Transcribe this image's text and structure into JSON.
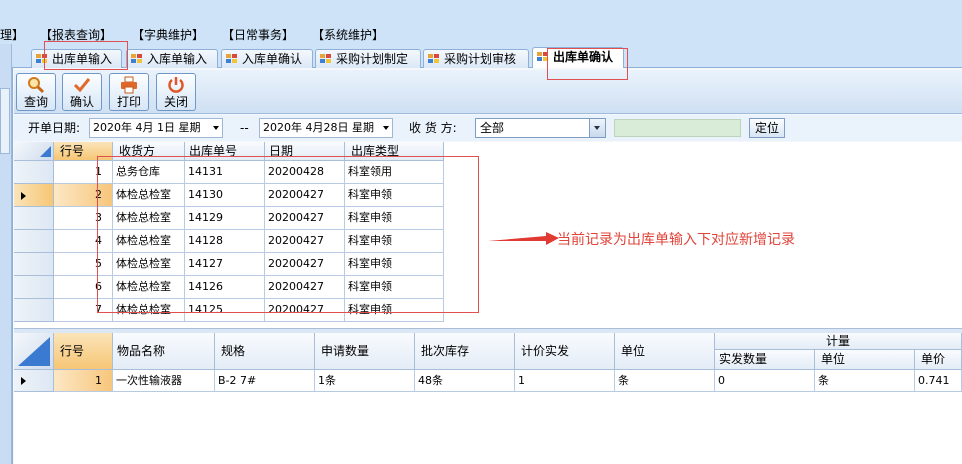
{
  "menu": {
    "items": [
      "理】",
      "【报表查询】",
      "【字典维护】",
      "【日常事务】",
      "【系统维护】"
    ]
  },
  "tabs": [
    {
      "label": "出库单输入",
      "active": false
    },
    {
      "label": "入库单输入",
      "active": false
    },
    {
      "label": "入库单确认",
      "active": false
    },
    {
      "label": "采购计划制定",
      "active": false
    },
    {
      "label": "采购计划审核",
      "active": false
    },
    {
      "label": "出库单确认",
      "active": true
    }
  ],
  "toolbar": {
    "query_label": "查询",
    "confirm_label": "确认",
    "print_label": "打印",
    "close_label": "关闭"
  },
  "filter": {
    "date_label": "开单日期:",
    "date_from": "2020年 4月 1日 星期",
    "separator": "--",
    "date_to": "2020年 4月28日 星期",
    "receiver_label": "收 货 方:",
    "receiver_value": "全部",
    "locate_label": "定位"
  },
  "top_grid": {
    "headers": [
      "行号",
      "收货方",
      "出库单号",
      "日期",
      "出库类型"
    ],
    "rows": [
      {
        "no": "1",
        "receiver": "总务仓库",
        "order_no": "14131",
        "date": "20200428",
        "type": "科室领用"
      },
      {
        "no": "2",
        "receiver": "体检总检室",
        "order_no": "14130",
        "date": "20200427",
        "type": "科室申领"
      },
      {
        "no": "3",
        "receiver": "体检总检室",
        "order_no": "14129",
        "date": "20200427",
        "type": "科室申领"
      },
      {
        "no": "4",
        "receiver": "体检总检室",
        "order_no": "14128",
        "date": "20200427",
        "type": "科室申领"
      },
      {
        "no": "5",
        "receiver": "体检总检室",
        "order_no": "14127",
        "date": "20200427",
        "type": "科室申领"
      },
      {
        "no": "6",
        "receiver": "体检总检室",
        "order_no": "14126",
        "date": "20200427",
        "type": "科室申领"
      },
      {
        "no": "7",
        "receiver": "体检总检室",
        "order_no": "14125",
        "date": "20200427",
        "type": "科室申领"
      }
    ],
    "current_row": 2
  },
  "annotation": "当前记录为出库单输入下对应新增记录",
  "bottom_grid": {
    "headers": {
      "no": "行号",
      "name": "物品名称",
      "spec": "规格",
      "req_qty": "申请数量",
      "batch_stock": "批次库存",
      "priced_qty": "计价实发",
      "unit": "单位",
      "group": "计量",
      "actual_qty": "实发数量",
      "sub_unit": "单位",
      "price": "单价"
    },
    "rows": [
      {
        "no": "1",
        "name": "一次性输液器",
        "spec": "B-2 7#",
        "req_qty": "1条",
        "batch_stock": "48条",
        "priced_qty": "1",
        "unit": "条",
        "actual_qty": "0",
        "sub_unit": "条",
        "price": "0.741"
      }
    ]
  },
  "colors": {
    "highlight_box": "#e05050",
    "annotation_text": "#e0443a",
    "selected_header": "#f6c675"
  }
}
